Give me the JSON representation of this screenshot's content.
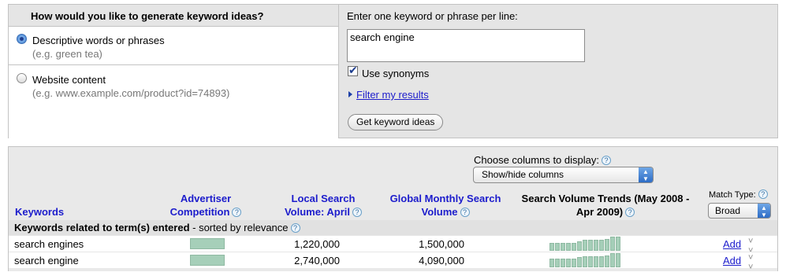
{
  "generate": {
    "question": "How would you like to generate keyword ideas?",
    "options": [
      {
        "label": "Descriptive words or phrases",
        "hint": "(e.g. green tea)",
        "selected": true
      },
      {
        "label": "Website content",
        "hint": "(e.g. www.example.com/product?id=74893)",
        "selected": false
      }
    ]
  },
  "input": {
    "instruction": "Enter one keyword or phrase per line:",
    "value": "search engine",
    "use_synonyms_label": "Use synonyms",
    "use_synonyms_checked": true,
    "filter_link": "Filter my results",
    "submit_label": "Get keyword ideas"
  },
  "columns": {
    "choose_label": "Choose columns to display:",
    "help_glyph": "?",
    "select_value": "Show/hide columns",
    "headers": {
      "keywords": "Keywords",
      "competition": [
        "Advertiser",
        "Competition"
      ],
      "local": [
        "Local Search",
        "Volume: April"
      ],
      "global": [
        "Global Monthly Search",
        "Volume"
      ],
      "trends": [
        "Search Volume Trends (May 2008 -",
        "Apr 2009)"
      ]
    },
    "match_type_label": "Match Type:",
    "match_type_value": "Broad"
  },
  "group": {
    "title": "Keywords related to term(s) entered",
    "sort_note": " - sorted by relevance"
  },
  "rows": [
    {
      "keyword": "search engines",
      "competition": 1.0,
      "local_volume": "1,220,000",
      "global_volume": "1,500,000",
      "trend": [
        0.55,
        0.55,
        0.55,
        0.55,
        0.55,
        0.65,
        0.75,
        0.75,
        0.75,
        0.8,
        0.85,
        1.0,
        1.0
      ],
      "action": "Add"
    },
    {
      "keyword": "search engine",
      "competition": 1.0,
      "local_volume": "2,740,000",
      "global_volume": "4,090,000",
      "trend": [
        0.6,
        0.6,
        0.6,
        0.6,
        0.6,
        0.7,
        0.75,
        0.75,
        0.75,
        0.8,
        0.85,
        1.0,
        1.0
      ],
      "action": "Add"
    }
  ],
  "colors": {
    "link": "#1c1ccc",
    "bar": "#a6cfb9",
    "panel": "#e5e5e5"
  }
}
